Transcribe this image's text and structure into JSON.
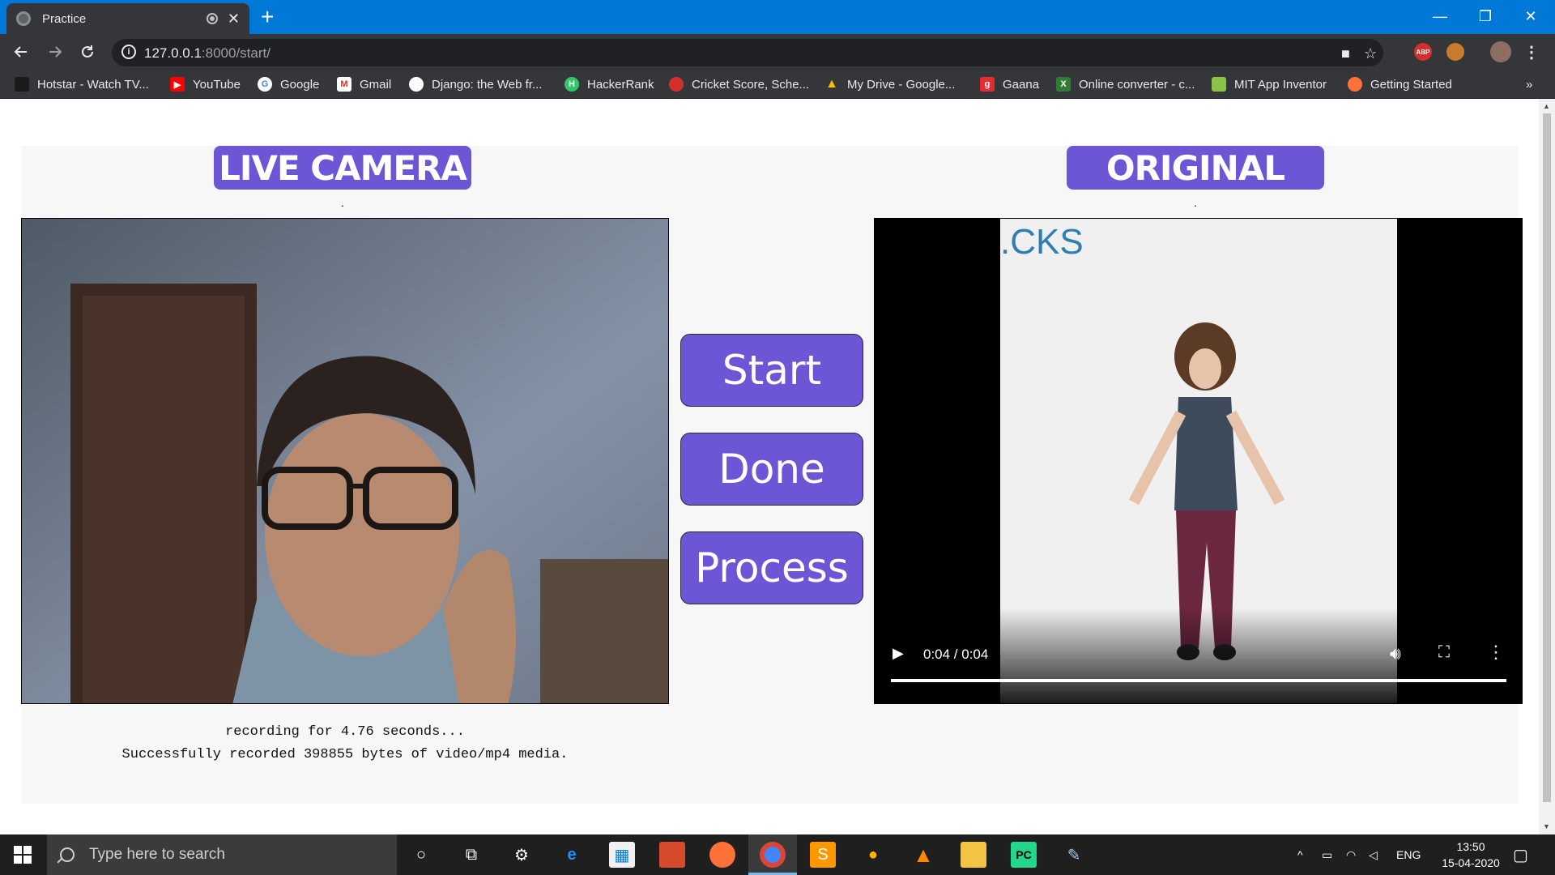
{
  "browser": {
    "tab_title": "Practice",
    "new_tab": "+",
    "url_host": "127.0.0.1",
    "url_path": ":8000/start/",
    "window_controls": {
      "minimize": "—",
      "restore": "❐",
      "close": "✕"
    },
    "tab_close": "✕",
    "extensions": {
      "abp": "ABP"
    },
    "bookmarks": [
      {
        "label": "Hotstar - Watch TV...",
        "icon": "hotstar-icon",
        "color": "#1b1b1b"
      },
      {
        "label": "YouTube",
        "icon": "youtube-icon",
        "color": "#ff0000"
      },
      {
        "label": "Google",
        "icon": "google-icon",
        "color": "#ffffff"
      },
      {
        "label": "Gmail",
        "icon": "gmail-icon",
        "color": "#ffffff"
      },
      {
        "label": "Django: the Web fr...",
        "icon": "django-icon",
        "color": "#ffffff"
      },
      {
        "label": "HackerRank",
        "icon": "hackerrank-icon",
        "color": "#2ec866"
      },
      {
        "label": "Cricket Score, Sche...",
        "icon": "cricket-icon",
        "color": "#d32f2f"
      },
      {
        "label": "My Drive - Google...",
        "icon": "drive-icon",
        "color": "#fbbc04"
      },
      {
        "label": "Gaana",
        "icon": "gaana-icon",
        "color": "#e72c30"
      },
      {
        "label": "Online converter - c...",
        "icon": "converter-icon",
        "color": "#2e7d32"
      },
      {
        "label": "MIT App Inventor",
        "icon": "appinventor-icon",
        "color": "#8bc34a"
      },
      {
        "label": "Getting Started",
        "icon": "firefox-icon",
        "color": "#ff7139"
      }
    ],
    "bookmarks_overflow": "»"
  },
  "page": {
    "live_heading": "LIVE CAMERA",
    "original_heading": "ORIGINAL",
    "dot": ".",
    "buttons": {
      "start": "Start",
      "done": "Done",
      "process": "Process"
    },
    "log_line_1": "recording for 4.76 seconds...",
    "log_line_2": "Successfully recorded 398855 bytes of video/mp4  media.",
    "video": {
      "overlay_text": ".CKS",
      "time": "0:04 / 0:04",
      "progress": 1.0
    },
    "accent_color": "#6c56d6"
  },
  "taskbar": {
    "search_placeholder": "Type here to search",
    "language": "ENG",
    "time": "13:50",
    "date": "15-04-2020"
  }
}
